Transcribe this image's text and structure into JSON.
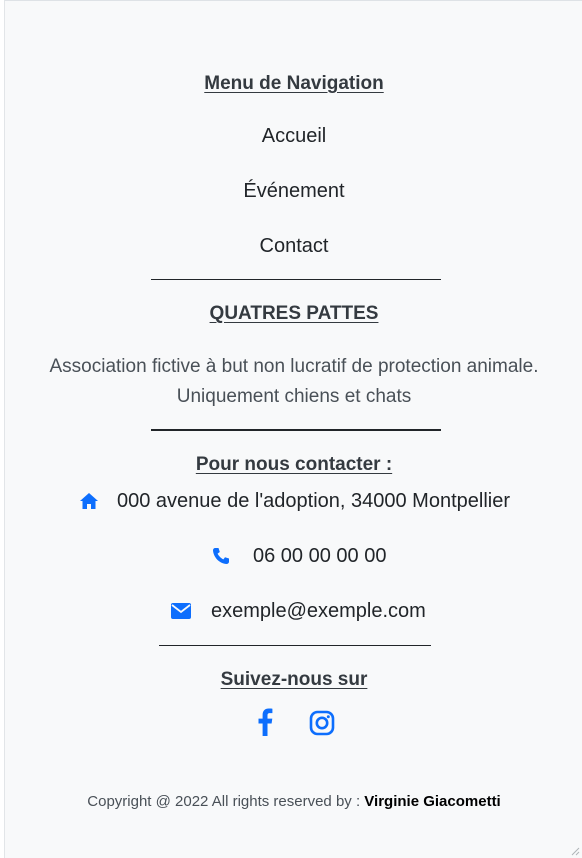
{
  "nav": {
    "title": "Menu de Navigation",
    "items": [
      {
        "label": "Accueil"
      },
      {
        "label": "Événement"
      },
      {
        "label": "Contact"
      }
    ]
  },
  "about": {
    "title": "QUATRES PATTES",
    "line1": "Association fictive à but non lucratif de protection animale.",
    "line2": "Uniquement chiens et chats"
  },
  "contact": {
    "title": "Pour nous contacter :",
    "address": "000 avenue de l'adoption, 34000 Montpellier",
    "phone": "06 00 00 00 00",
    "email": "exemple@exemple.com",
    "icons": [
      "home-icon",
      "phone-icon",
      "envelope-icon"
    ]
  },
  "social": {
    "title": "Suivez-nous sur",
    "icons": [
      "facebook-icon",
      "instagram-icon"
    ]
  },
  "footer": {
    "copyright": "Copyright @ 2022 All rights reserved by :",
    "author": "Virginie Giacometti"
  },
  "colors": {
    "accent": "#0d6efd",
    "text": "#212529",
    "heading": "#343a40",
    "background": "#f8f9fa"
  }
}
